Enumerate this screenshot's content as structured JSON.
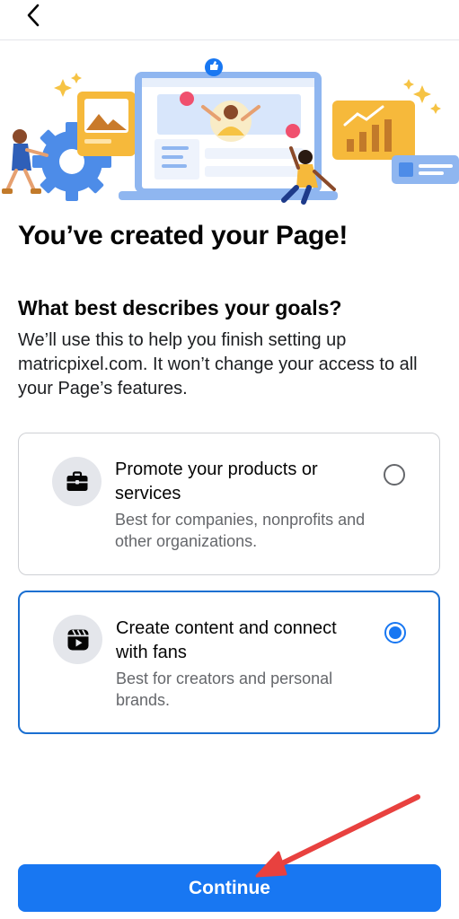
{
  "header": {
    "back_icon": "chevron-left-icon"
  },
  "main": {
    "title": "You’ve created your Page!",
    "question": "What best describes your goals?",
    "description": "We’ll use this to help you finish setting up matricpixel.com. It won’t change your access to all your Page’s features."
  },
  "options": [
    {
      "icon": "briefcase-icon",
      "title": "Promote your products or services",
      "subtitle": "Best for companies, nonprofits and other organizations.",
      "selected": false
    },
    {
      "icon": "reels-icon",
      "title": "Create content and connect with fans",
      "subtitle": "Best for creators and personal brands.",
      "selected": true
    }
  ],
  "footer": {
    "continue_label": "Continue"
  },
  "colors": {
    "accent": "#1877f2",
    "annotation_arrow": "#e8413f"
  }
}
